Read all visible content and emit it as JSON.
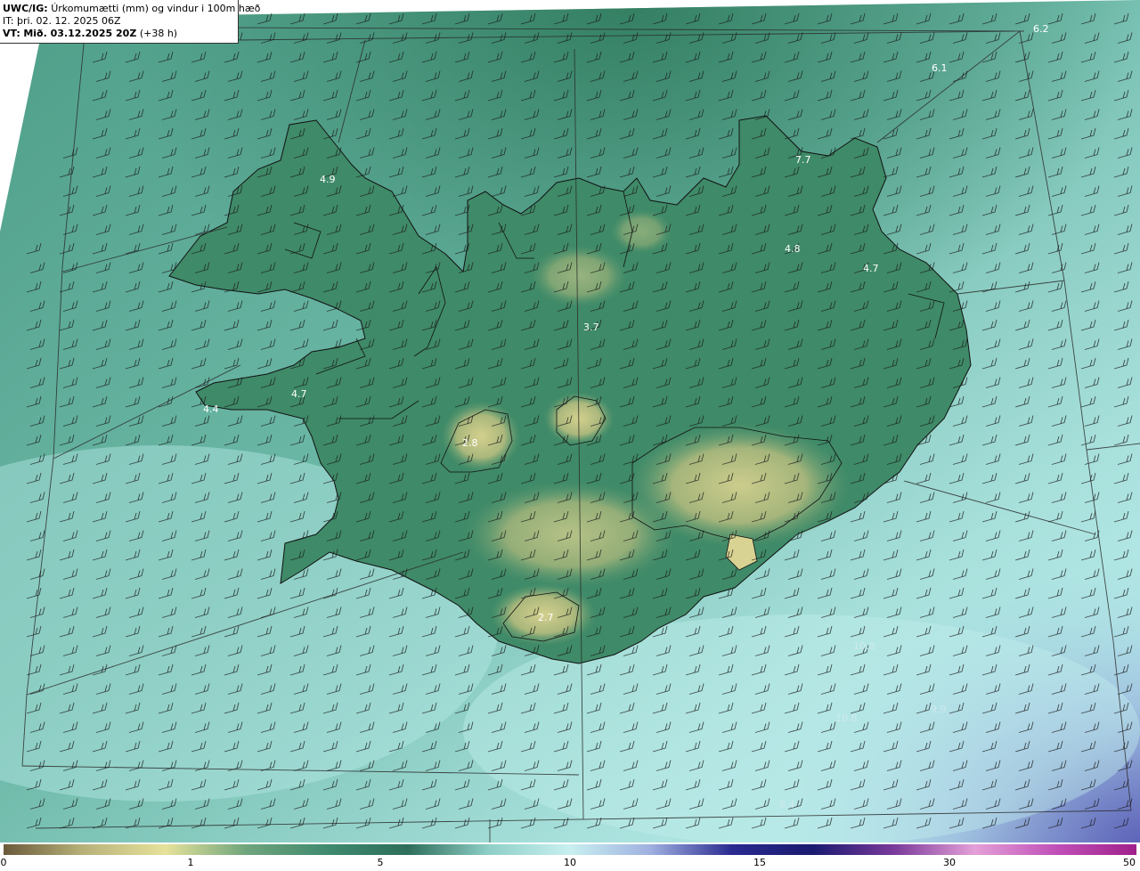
{
  "header": {
    "model": "UWC/IG:",
    "title": "Úrkomumætti (mm) og vindur i 100m hæð",
    "it_line": "IT: þri. 02. 12. 2025 06Z",
    "vt_prefix": "VT:",
    "vt_bold": "Mið. 03.12.2025 20Z",
    "vt_suffix": "(+38 h)"
  },
  "map_labels": [
    {
      "text": "6.2",
      "color": "#ffffff"
    },
    {
      "text": "4.9",
      "color": "#ffffff"
    },
    {
      "text": "4.8",
      "color": "#ffffff"
    },
    {
      "text": "4.7",
      "color": "#ffffff"
    },
    {
      "text": "3.7",
      "color": "#ffffff"
    },
    {
      "text": "4.7",
      "color": "#ffffff"
    },
    {
      "text": "4.4",
      "color": "#ffffff"
    },
    {
      "text": "2.8",
      "color": "#ffffff"
    },
    {
      "text": "2.7",
      "color": "#ffffff"
    },
    {
      "text": "7.7",
      "color": "#ffffff"
    },
    {
      "text": "6.1",
      "color": "#ffffff"
    },
    {
      "text": "10.8",
      "color": "#cfe8ee"
    },
    {
      "text": "10.8",
      "color": "#cfe8ee"
    },
    {
      "text": "9.9",
      "color": "#cfe8ee"
    },
    {
      "text": "8.4",
      "color": "#cfe8ee"
    }
  ],
  "colorbar": {
    "ticks": [
      "0",
      "1",
      "5",
      "10",
      "15",
      "30",
      "50"
    ],
    "stops": [
      "#6b5a3a",
      "#b8b27a",
      "#e6e29a",
      "#6fa57c",
      "#3f8a6f",
      "#2e6e5a",
      "#8fd0c8",
      "#c8f0f0",
      "#9fb0e0",
      "#2a2a90",
      "#1a1a70",
      "#7a3a9a",
      "#e4a0d8",
      "#c050b8",
      "#a0208a"
    ]
  },
  "legend_unit": "mm",
  "colors": {
    "sea_light": "#a9ddd8",
    "sea_mid": "#6fb8a9",
    "land_dark": "#3b7e64",
    "land_high": "#c7cc8a",
    "coast": "#111111",
    "grid": "#333333",
    "barb": "#1b1b1b"
  }
}
